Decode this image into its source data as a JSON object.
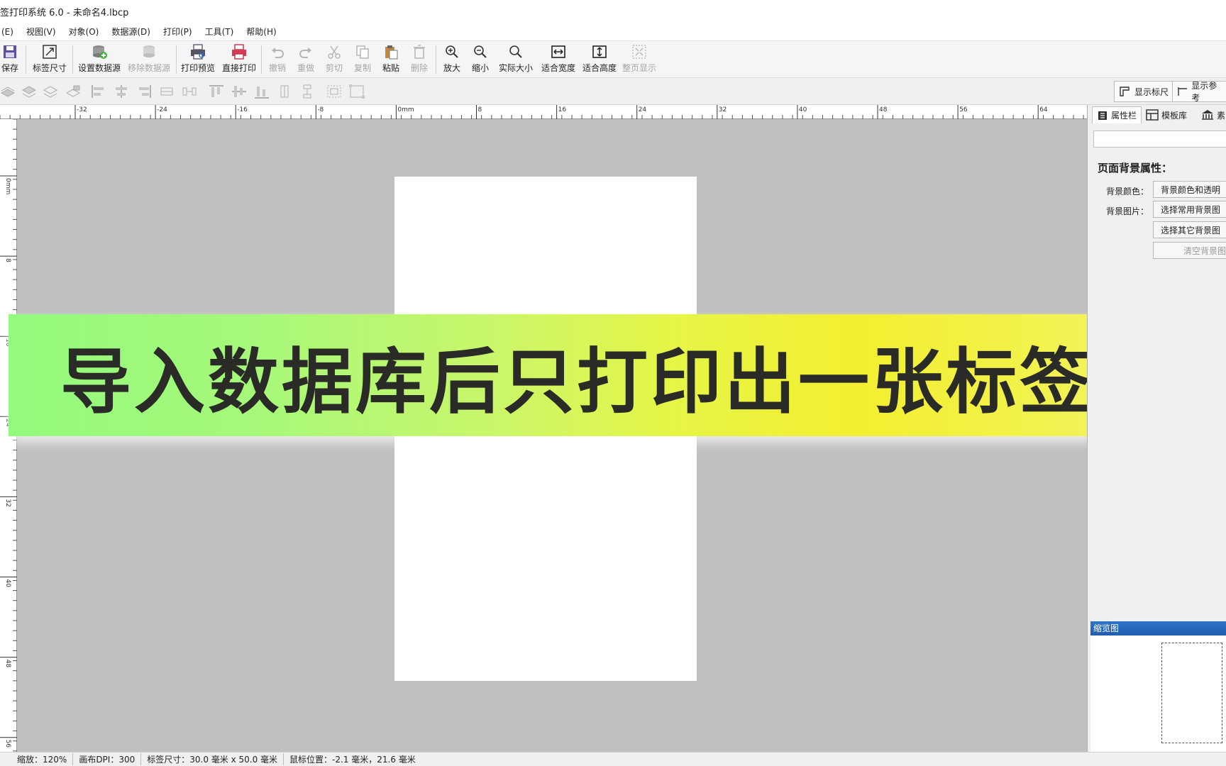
{
  "window": {
    "title": "签打印系统 6.0 - 未命名4.lbcp"
  },
  "menu": [
    "(E)",
    "视图(V)",
    "对象(O)",
    "数据源(D)",
    "打印(P)",
    "工具(T)",
    "帮助(H)"
  ],
  "toolbar": {
    "save": "保存",
    "label_size": "标签尺寸",
    "set_datasource": "设置数据源",
    "remove_datasource": "移除数据源",
    "print_preview": "打印预览",
    "direct_print": "直接打印",
    "undo": "撤销",
    "redo": "重做",
    "cut": "剪切",
    "copy": "复制",
    "paste": "粘贴",
    "delete": "删除",
    "zoom_in": "放大",
    "zoom_out": "缩小",
    "actual_size": "实际大小",
    "fit_width": "适合宽度",
    "fit_height": "适合高度",
    "fit_page": "整页显示"
  },
  "toggles": {
    "show_ruler": "显示标尺",
    "show_reference": "显示参考"
  },
  "ruler_top_ticks": [
    "-32",
    "-24",
    "-16",
    "-8",
    "0mm",
    "8",
    "16",
    "24",
    "32",
    "40",
    "48",
    "56",
    "64"
  ],
  "ruler_left_ticks": [
    "0mm",
    "8",
    "16",
    "24",
    "32",
    "40",
    "48",
    "56"
  ],
  "banner": {
    "text": "导入数据库后只打印出一张标签？"
  },
  "panel": {
    "tabs": [
      "属性栏",
      "模板库",
      "素"
    ],
    "section_title": "页面背景属性：",
    "bg_color_label": "背景颜色：",
    "bg_image_label": "背景图片：",
    "btn_bg_color": "背景颜色和透明",
    "btn_common_bg": "选择常用背景图",
    "btn_other_bg": "选择其它背景图",
    "btn_clear_bg": "清空背景图",
    "thumbnail_title": "缩览图"
  },
  "status": {
    "zoom": "缩放：120%",
    "dpi": "画布DPI：300",
    "label_size": "标签尺寸：30.0 毫米 x 50.0 毫米",
    "mouse_pos": "鼠标位置：-2.1 毫米，21.6 毫米"
  }
}
